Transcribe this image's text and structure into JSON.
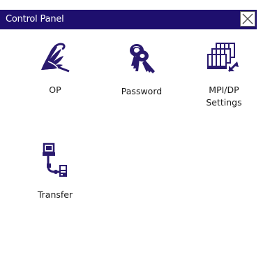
{
  "window": {
    "title": "Control Panel"
  },
  "apps": [
    {
      "label": "OP",
      "icon": "op-icon"
    },
    {
      "label": "Password",
      "icon": "keys-icon"
    },
    {
      "label_line1": "MPI/DP",
      "label_line2": "Settings",
      "icon": "network-settings-icon"
    },
    {
      "label": "Transfer",
      "icon": "transfer-icon"
    }
  ],
  "colors": {
    "titlebar_bg": "#1e0f6e",
    "titlebar_text": "#ffffff",
    "icon_color": "#2a1a6e",
    "window_bg": "#ffffff"
  }
}
